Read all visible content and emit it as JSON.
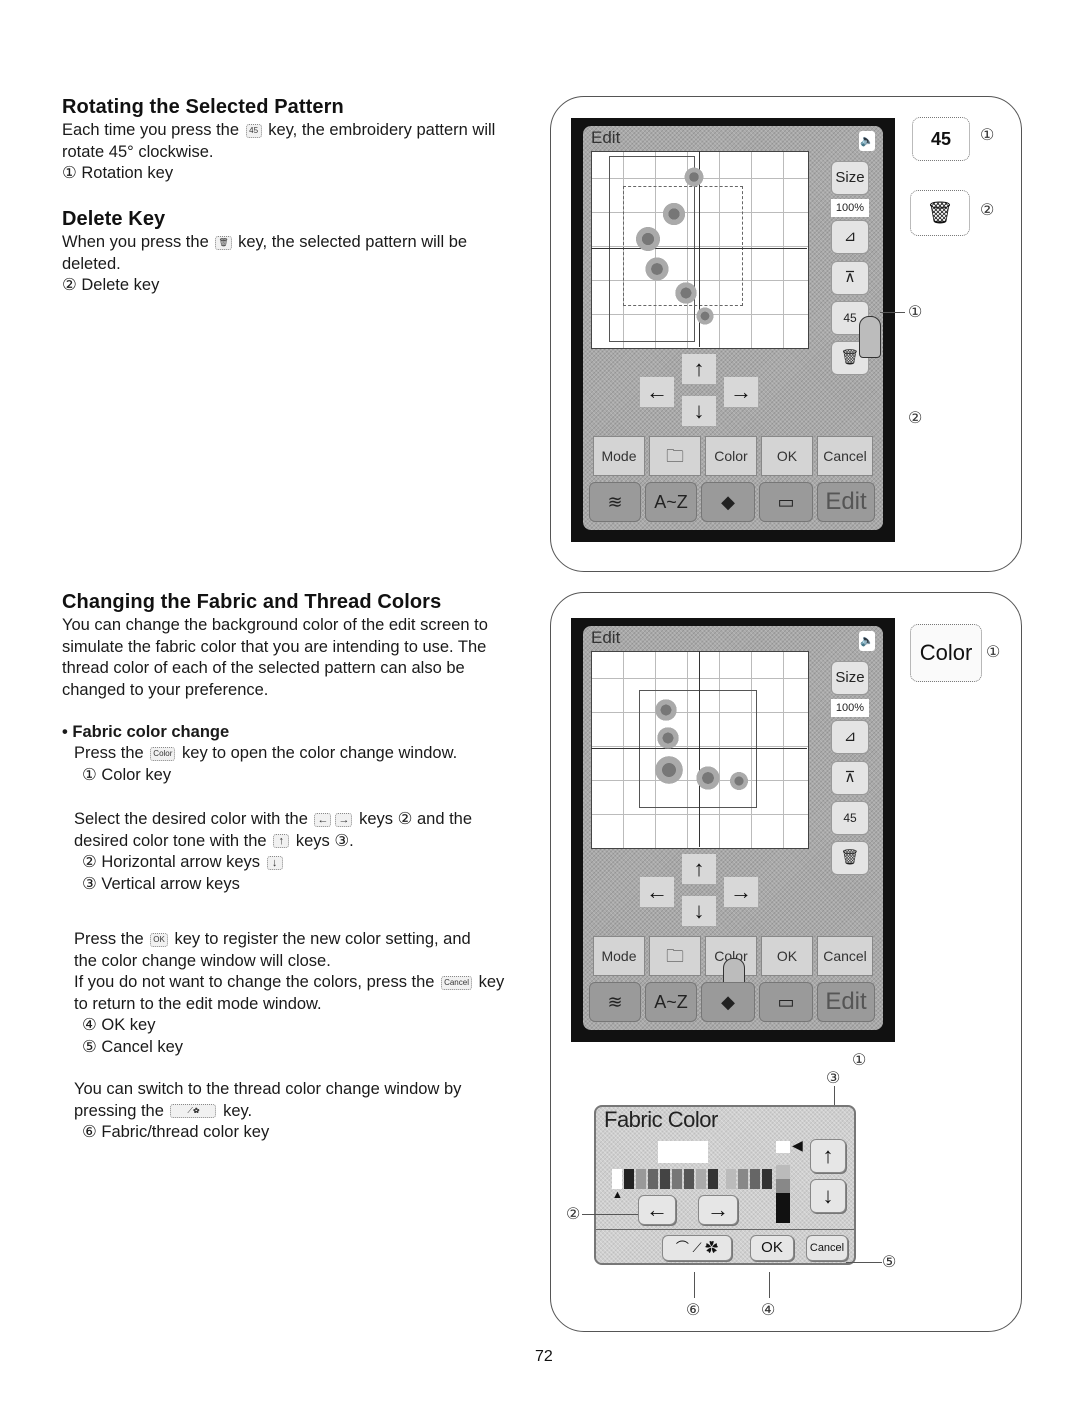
{
  "rotating": {
    "heading": "Rotating the Selected Pattern",
    "line1_a": "Each time you press the",
    "key_icon_label": "45",
    "line1_b": "key, the embroidery pattern will",
    "line2": "rotate 45° clockwise.",
    "item1": "① Rotation key"
  },
  "delete": {
    "heading": "Delete Key",
    "line1_a": "When you press the",
    "line1_b": "key, the selected pattern will be",
    "line2": "deleted.",
    "item2": "② Delete key"
  },
  "changing": {
    "heading": "Changing the Fabric and Thread Colors",
    "intro": [
      "You can change the background color of the edit screen to",
      "simulate the fabric color that you are intending to use. The",
      "thread color of each of the selected pattern can also be",
      "changed to your preference."
    ],
    "bullet_heading": "• Fabric color change",
    "press_a": "Press the",
    "color_key_icon": "Color",
    "press_b": "key to open the color change window.",
    "item1": "① Color key",
    "select_a": "Select the desired color with the",
    "left_icon": "←",
    "right_icon": "→",
    "select_b": "keys ② and the",
    "tone_a": "desired color tone with the",
    "up_icon": "↑",
    "down_icon": "↓",
    "tone_b": "keys ③.",
    "item2": "② Horizontal arrow keys",
    "item3": "③ Vertical arrow keys",
    "ok_a": "Press the",
    "ok_icon": "OK",
    "ok_b": "key to register the new color setting, and",
    "ok_line2": "the color change window will close.",
    "cancel_a": "If you do not want to change the colors, press the",
    "cancel_icon": "Cancel",
    "cancel_b": "key",
    "cancel_line2": "to return to the edit mode window.",
    "item4": "④ OK key",
    "item5": "⑤ Cancel key",
    "switch_line1": "You can switch to the thread color change window by",
    "switch_a": "pressing the",
    "switch_b": "key.",
    "item6": "⑥ Fabric/thread color key"
  },
  "screen": {
    "title": "Edit",
    "speaker_icon": "🔈",
    "size_label": "Size",
    "zoom_value": "100%",
    "rotate_label": "45",
    "buttons": [
      "Mode",
      "Color",
      "OK",
      "Cancel"
    ],
    "bottom_tabs": [
      "A~Z",
      "Edit"
    ]
  },
  "figure1_callouts": {
    "c1": "①",
    "c2": "②",
    "rot_icon_label": "45"
  },
  "figure2_callouts": {
    "color_key_label": "Color",
    "c1": "①"
  },
  "fabric_dialog": {
    "title": "Fabric Color",
    "ok_label": "OK",
    "cancel_label": "Cancel",
    "callouts": [
      "①",
      "②",
      "③",
      "④",
      "⑤",
      "⑥"
    ]
  },
  "page_number": "72"
}
